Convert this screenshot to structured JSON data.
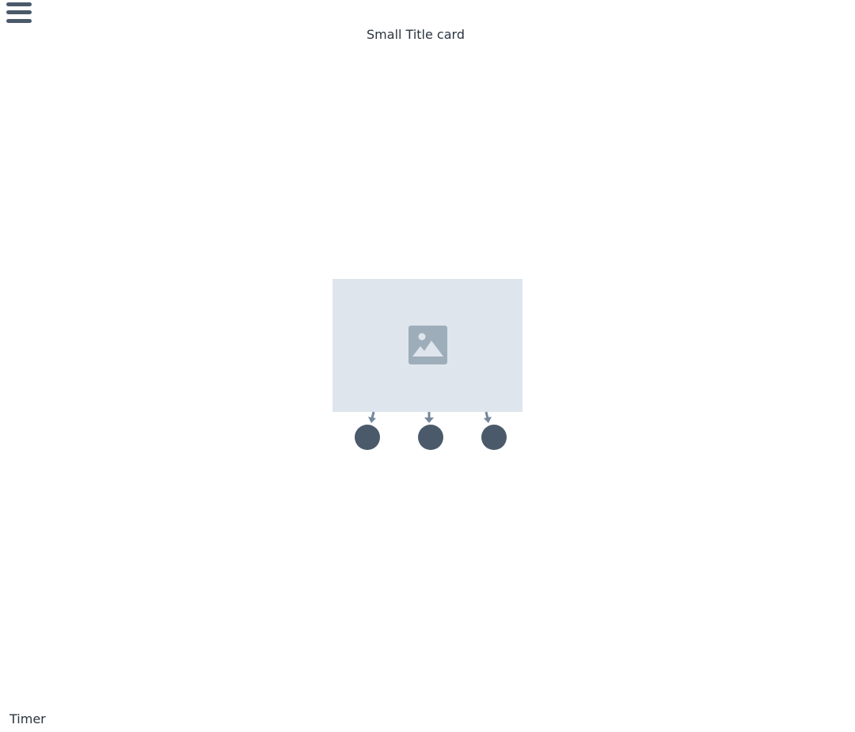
{
  "header": {
    "menu_icon": "hamburger-icon",
    "title": "Small Title card"
  },
  "card": {
    "image_icon": "image-placeholder-icon",
    "dots": 3
  },
  "footer": {
    "timer_label": "Timer"
  },
  "colors": {
    "dot": "#4a5a6b",
    "image_bg": "#dfe5ec",
    "icon": "#9eadba",
    "arrow": "#74889b"
  }
}
